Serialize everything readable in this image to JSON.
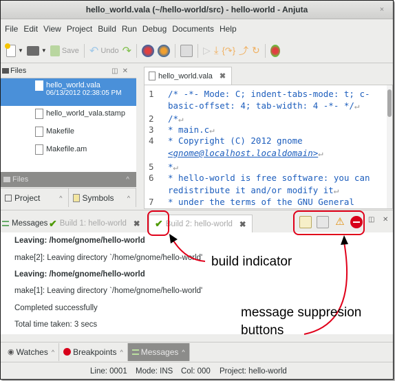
{
  "window": {
    "title": "hello_world.vala (~/hello-world/src) - hello-world - Anjuta",
    "close_glyph": "×"
  },
  "menu": [
    "File",
    "Edit",
    "View",
    "Project",
    "Build",
    "Run",
    "Debug",
    "Documents",
    "Help"
  ],
  "toolbar": {
    "save_label": "Save",
    "undo_label": "Undo"
  },
  "files_panel": {
    "title": "Files",
    "items": [
      {
        "name": "hello_world.vala",
        "date": "06/13/2012 02:38:05 PM",
        "selected": true
      },
      {
        "name": "hello_world_vala.stamp"
      },
      {
        "name": "Makefile"
      },
      {
        "name": "Makefile.am"
      }
    ],
    "collapsed_bar": "Files",
    "tabs": [
      {
        "label": "Project"
      },
      {
        "label": "Symbols"
      }
    ]
  },
  "editor": {
    "tab_label": "hello_world.vala",
    "tab_close": "✖",
    "lines": [
      {
        "num": "1",
        "text": "/* -*- Mode: C; indent-tabs-mode: t; c-"
      },
      {
        "num": "",
        "text": "basic-offset: 4; tab-width: 4 -*- */"
      },
      {
        "num": "2",
        "text": "/*"
      },
      {
        "num": "3",
        "text": " * main.c"
      },
      {
        "num": "4",
        "text": " * Copyright (C) 2012 gnome"
      },
      {
        "num": "",
        "text": "<gnome@localhost.localdomain>"
      },
      {
        "num": "5",
        "text": " *"
      },
      {
        "num": "6",
        "text": " * hello-world is free software: you can"
      },
      {
        "num": "",
        "text": "redistribute it and/or modify it"
      },
      {
        "num": "7",
        "text": " * under the terms of the GNU General"
      }
    ]
  },
  "messages": {
    "panel_title": "Messages",
    "tabs": [
      {
        "label": "Build 1: hello-world",
        "close": "✖"
      },
      {
        "label": "Build 2: hello-world",
        "close": "✖"
      }
    ],
    "lines": [
      {
        "text": "Leaving: /home/gnome/hello-world",
        "bold": true
      },
      {
        "text": "make[2]: Leaving directory `/home/gnome/hello-world'",
        "bold": false
      },
      {
        "text": "Leaving: /home/gnome/hello-world",
        "bold": true
      },
      {
        "text": "make[1]: Leaving directory `/home/gnome/hello-world'",
        "bold": false
      },
      {
        "text": "Completed successfully",
        "bold": false
      },
      {
        "text": "Total time taken: 3 secs",
        "bold": false
      }
    ]
  },
  "bottom_tabs": [
    {
      "label": "Watches"
    },
    {
      "label": "Breakpoints"
    },
    {
      "label": "Messages"
    }
  ],
  "status": {
    "line": "Line: 0001",
    "mode": "Mode: INS",
    "col": "Col: 000",
    "project": "Project: hello-world"
  },
  "annotations": {
    "build_indicator": "build indicator",
    "msg_suppression_1": "message suppresion",
    "msg_suppression_2": "buttons"
  },
  "colors": {
    "selection": "#4a90d9",
    "annotation_red": "#e0001a",
    "code_blue": "#1d5ebd",
    "check_green": "#4e9a06"
  }
}
